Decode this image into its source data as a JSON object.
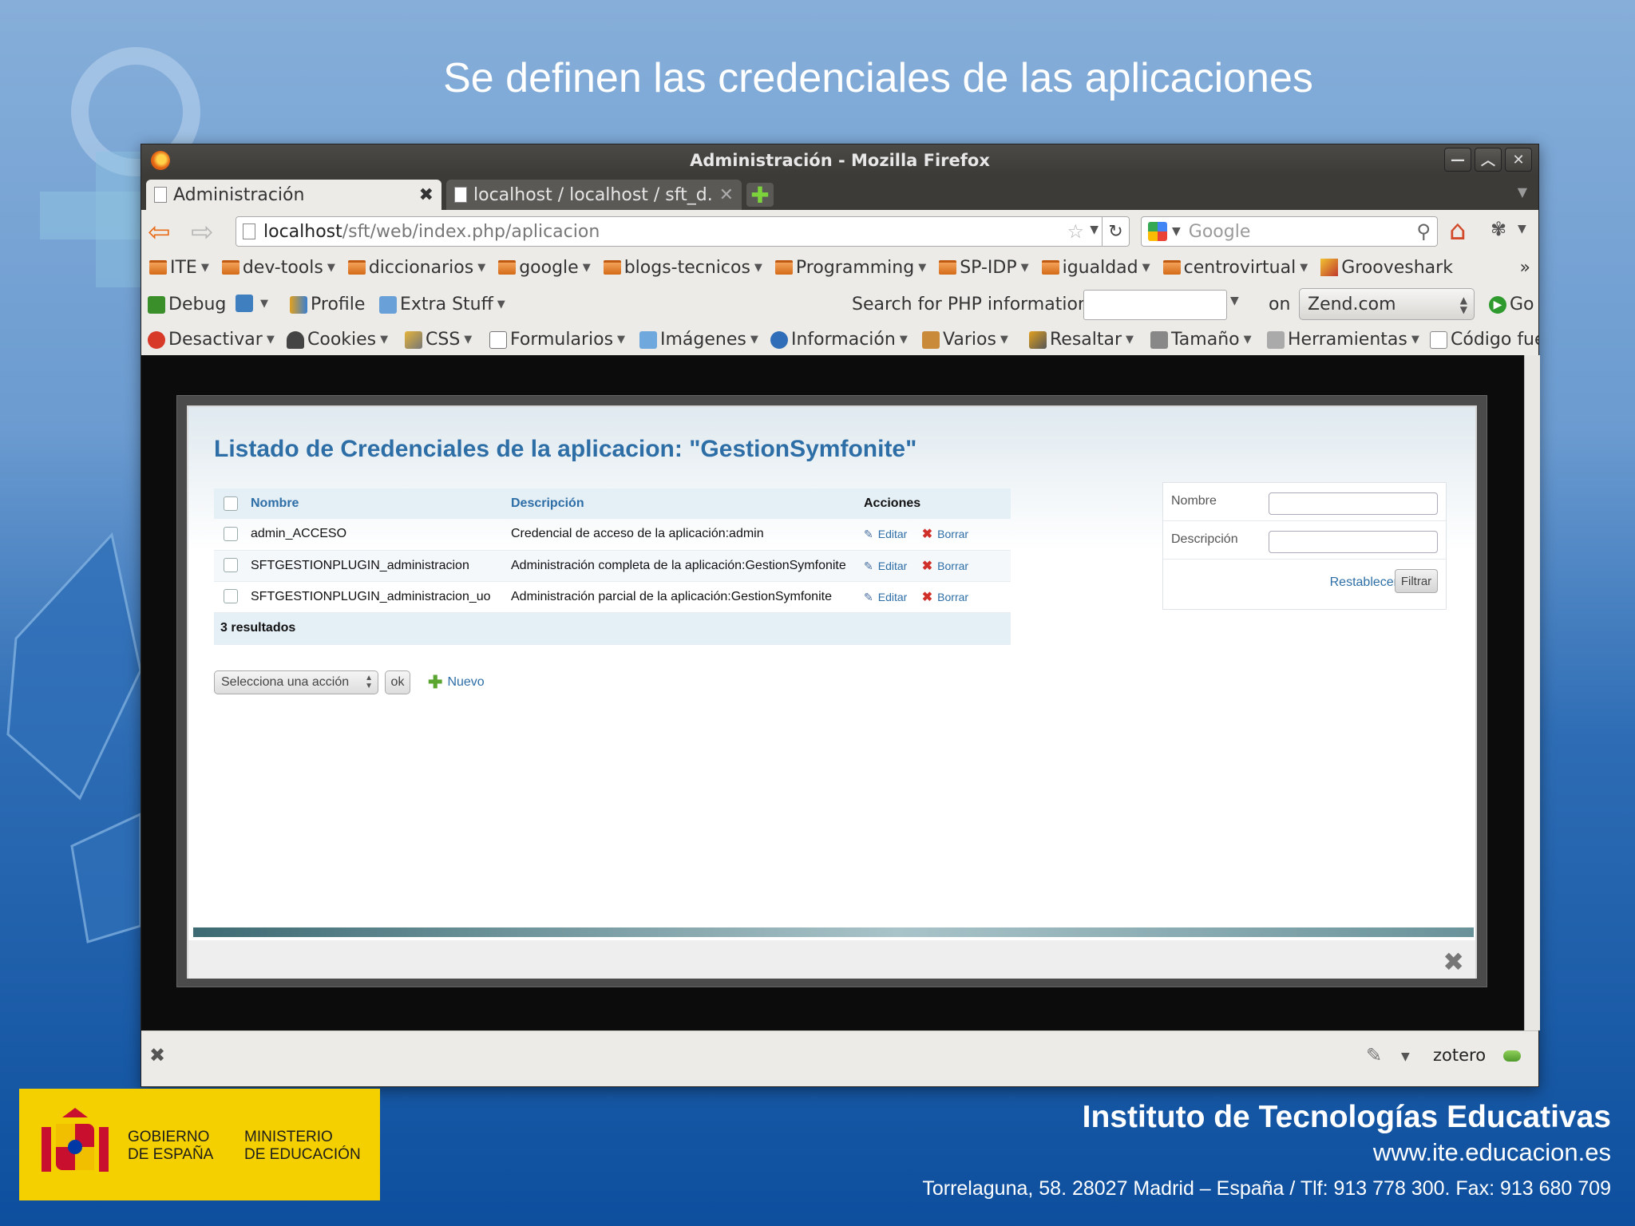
{
  "slide": {
    "title": "Se definen las credenciales de las aplicaciones"
  },
  "window": {
    "title": "Administración - Mozilla Firefox",
    "controls": [
      "—",
      "︿",
      "✕"
    ]
  },
  "tabs": [
    {
      "label": "Administración",
      "close": "✖"
    },
    {
      "label": "localhost / localhost / sft_d...",
      "close": "✕"
    }
  ],
  "newtab": "✚",
  "urlbar": {
    "host": "localhost",
    "path": "/sft/web/index.php/aplicacion"
  },
  "search": {
    "placeholder": "Google"
  },
  "bookmarks": [
    {
      "label": "ITE",
      "icon": "folder-icon",
      "dropdown": true
    },
    {
      "label": "dev-tools",
      "icon": "folder-icon",
      "dropdown": true
    },
    {
      "label": "diccionarios",
      "icon": "folder-icon",
      "dropdown": true
    },
    {
      "label": "google",
      "icon": "folder-icon",
      "dropdown": true
    },
    {
      "label": "blogs-tecnicos",
      "icon": "folder-icon",
      "dropdown": true
    },
    {
      "label": "Programming",
      "icon": "folder-icon",
      "dropdown": true
    },
    {
      "label": "SP-IDP",
      "icon": "folder-icon",
      "dropdown": true
    },
    {
      "label": "igualdad",
      "icon": "folder-icon",
      "dropdown": true
    },
    {
      "label": "centrovirtual",
      "icon": "folder-icon",
      "dropdown": true
    },
    {
      "label": "Grooveshark",
      "icon": "grooveshark-icon",
      "dropdown": false
    }
  ],
  "bookmarks_more": "»",
  "phpbar": {
    "debug": "Debug",
    "profile": "Profile",
    "extra": "Extra Stuff",
    "search_label": "Search for PHP information:",
    "on": "on",
    "site": "Zend.com",
    "go": "Go"
  },
  "webdev": [
    "Desactivar",
    "Cookies",
    "CSS",
    "Formularios",
    "Imágenes",
    "Información",
    "Varios",
    "Resaltar",
    "Tamaño",
    "Herramientas",
    "Código fue"
  ],
  "page": {
    "heading": "Listado de Credenciales de la aplicacion: \"GestionSymfonite\"",
    "columns": {
      "name": "Nombre",
      "desc": "Descripción",
      "actions": "Acciones"
    },
    "rows": [
      {
        "name": "admin_ACCESO",
        "desc": "Credencial de acceso de la aplicación:admin"
      },
      {
        "name": "SFTGESTIONPLUGIN_administracion",
        "desc": "Administración completa de la aplicación:GestionSymfonite"
      },
      {
        "name": "SFTGESTIONPLUGIN_administracion_uo",
        "desc": "Administración parcial de la aplicación:GestionSymfonite"
      }
    ],
    "edit_label": "Editar",
    "delete_label": "Borrar",
    "results": "3 resultados",
    "batch_select": "Selecciona una acción",
    "ok": "ok",
    "new": "Nuevo",
    "filter": {
      "name_label": "Nombre",
      "desc_label": "Descripción",
      "reset": "Restablecer",
      "submit": "Filtrar"
    }
  },
  "statusbar": {
    "zotero": "zotero"
  },
  "footer": {
    "gov1": "GOBIERNO",
    "gov2": "DE ESPAÑA",
    "min1": "MINISTERIO",
    "min2": "DE EDUCACIÓN",
    "org": "Instituto de Tecnologías Educativas",
    "url": "www.ite.educacion.es",
    "address": "Torrelaguna, 58. 28027 Madrid – España / Tlf: 913 778 300. Fax: 913 680 709"
  },
  "colors": {
    "accent_blue": "#2d6ea6",
    "gov_yellow": "#f5d000",
    "firefox_orange": "#e86c1a"
  }
}
